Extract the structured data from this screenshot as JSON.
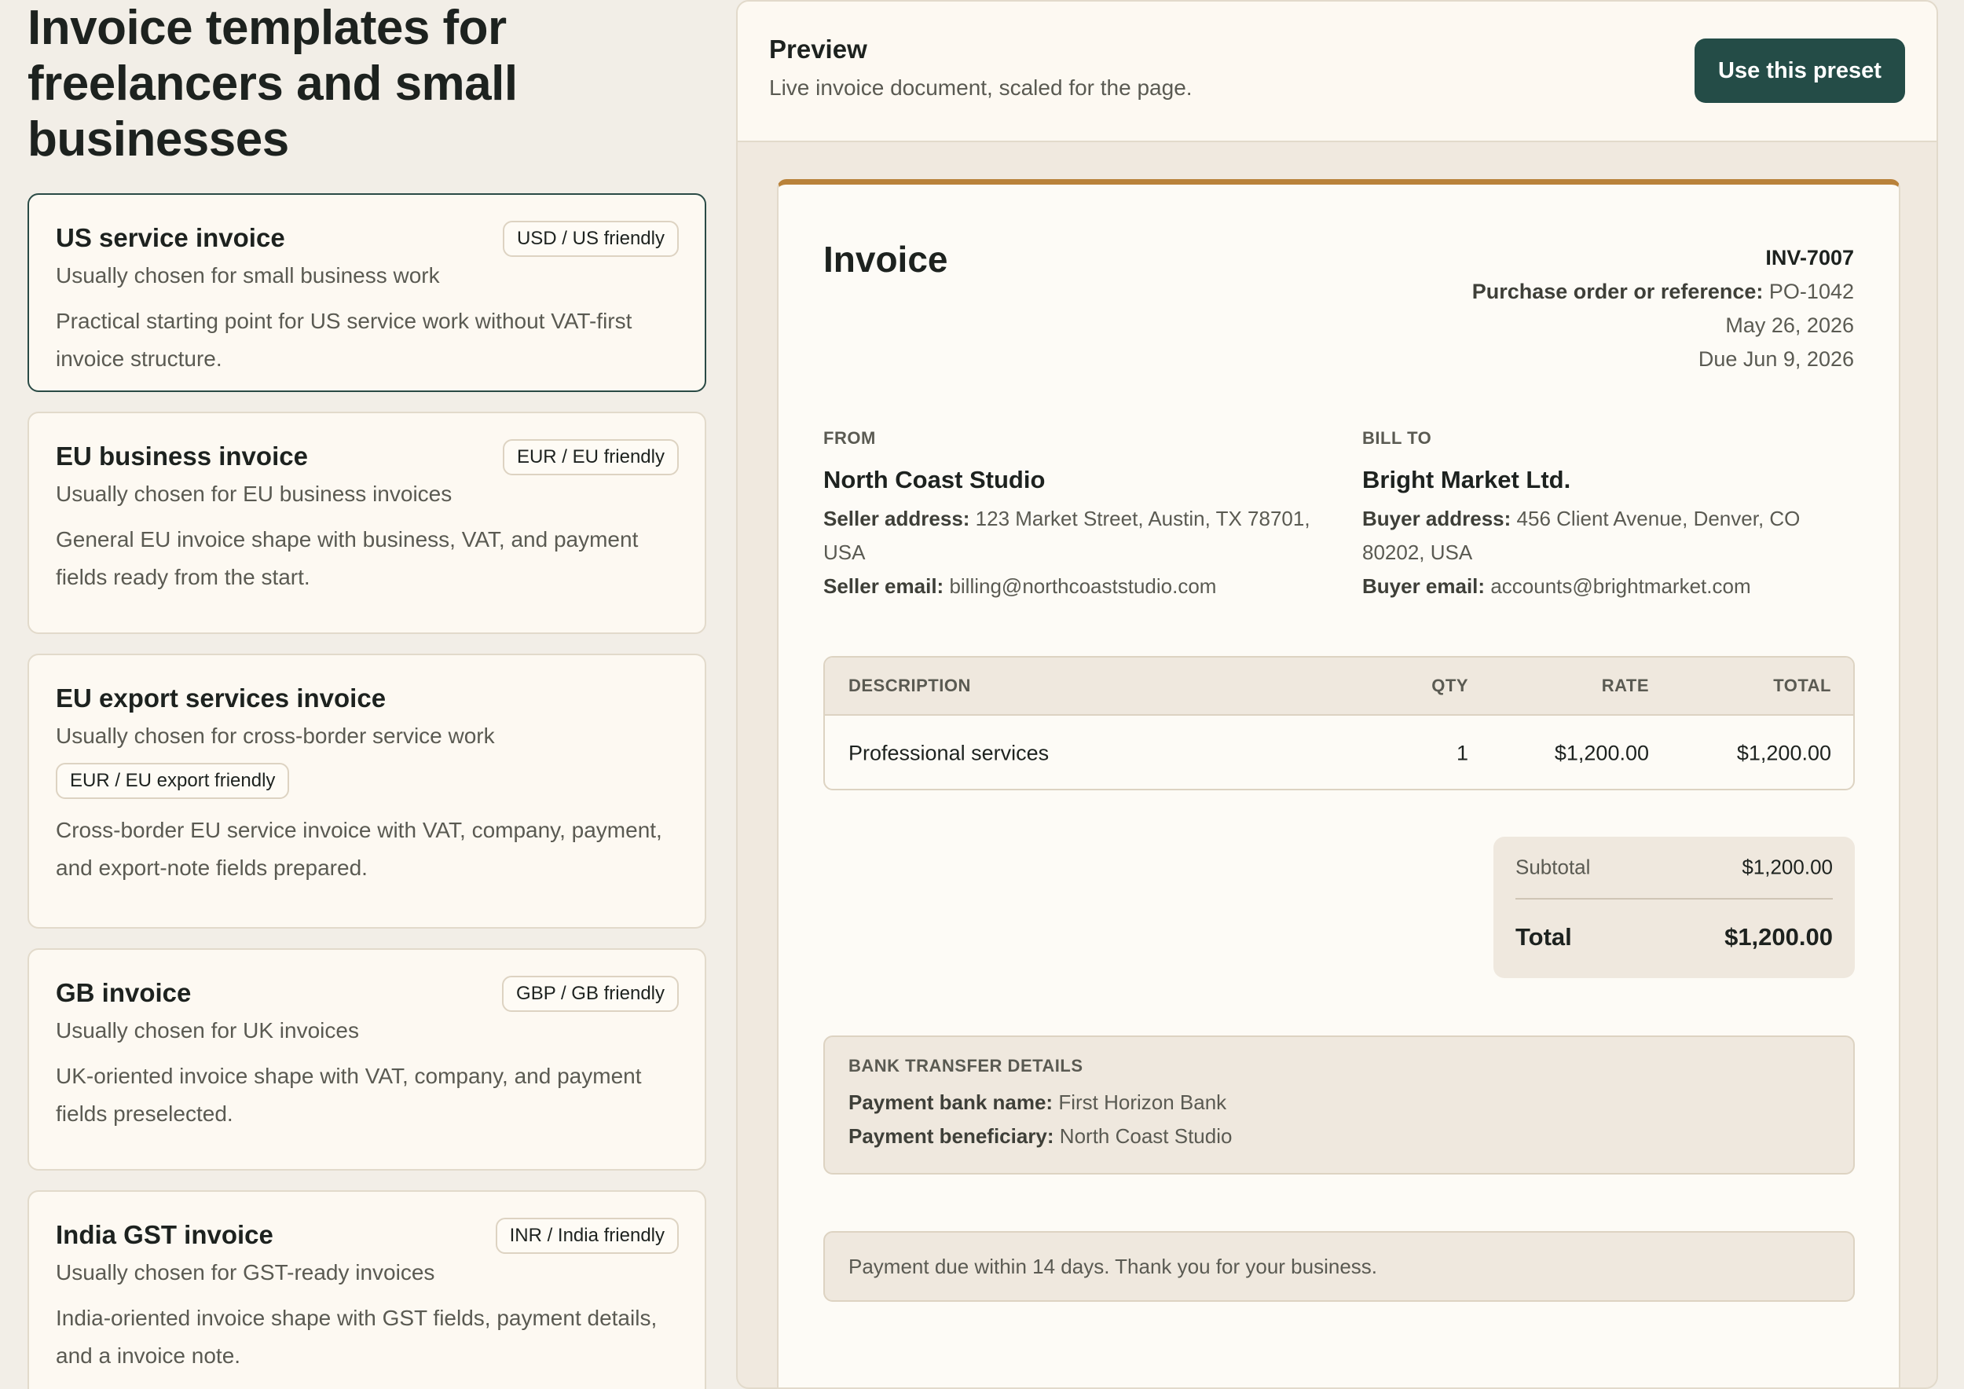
{
  "page": {
    "title": "Invoice templates for freelancers and small businesses"
  },
  "templates": [
    {
      "name": "US service invoice",
      "subtitle": "Usually chosen for small business work",
      "badge": "USD / US friendly",
      "description": "Practical starting point for US service work without VAT-first invoice structure.",
      "selected": true
    },
    {
      "name": "EU business invoice",
      "subtitle": "Usually chosen for EU business invoices",
      "badge": "EUR / EU friendly",
      "description": "General EU invoice shape with business, VAT, and payment fields ready from the start."
    },
    {
      "name": "EU export services invoice",
      "subtitle": "Usually chosen for cross-border service work",
      "badge": "EUR / EU export friendly",
      "description": "Cross-border EU service invoice with VAT, company, payment, and export-note fields prepared."
    },
    {
      "name": "GB invoice",
      "subtitle": "Usually chosen for UK invoices",
      "badge": "GBP / GB friendly",
      "description": "UK-oriented invoice shape with VAT, company, and payment fields preselected."
    },
    {
      "name": "India GST invoice",
      "subtitle": "Usually chosen for GST-ready invoices",
      "badge": "INR / India friendly",
      "description": "India-oriented invoice shape with GST fields, payment details, and a invoice note."
    }
  ],
  "preview": {
    "title": "Preview",
    "subtitle": "Live invoice document, scaled for the page.",
    "button_label": "Use this preset",
    "accent_color": "#b9823a",
    "button_color": "#244c47"
  },
  "invoice": {
    "title": "Invoice",
    "number": "INV-7007",
    "reference_label": "Purchase order or reference:",
    "reference_value": "PO-1042",
    "date": "May 26, 2026",
    "due": "Due Jun 9, 2026",
    "from": {
      "label": "FROM",
      "name": "North Coast Studio",
      "address_label": "Seller address:",
      "address_value": "123 Market Street, Austin, TX 78701, USA",
      "email_label": "Seller email:",
      "email_value": "billing@northcoaststudio.com"
    },
    "to": {
      "label": "BILL TO",
      "name": "Bright Market Ltd.",
      "address_label": "Buyer address:",
      "address_value": "456 Client Avenue, Denver, CO 80202, USA",
      "email_label": "Buyer email:",
      "email_value": "accounts@brightmarket.com"
    },
    "table": {
      "headers": {
        "description": "DESCRIPTION",
        "qty": "QTY",
        "rate": "RATE",
        "total": "TOTAL"
      },
      "rows": [
        {
          "description": "Professional services",
          "qty": "1",
          "rate": "$1,200.00",
          "total": "$1,200.00"
        }
      ]
    },
    "totals": {
      "subtotal_label": "Subtotal",
      "subtotal_value": "$1,200.00",
      "total_label": "Total",
      "total_value": "$1,200.00"
    },
    "bank": {
      "label": "BANK TRANSFER DETAILS",
      "bank_name_label": "Payment bank name:",
      "bank_name_value": "First Horizon Bank",
      "beneficiary_label": "Payment beneficiary:",
      "beneficiary_value": "North Coast Studio"
    },
    "note": "Payment due within 14 days. Thank you for your business."
  }
}
